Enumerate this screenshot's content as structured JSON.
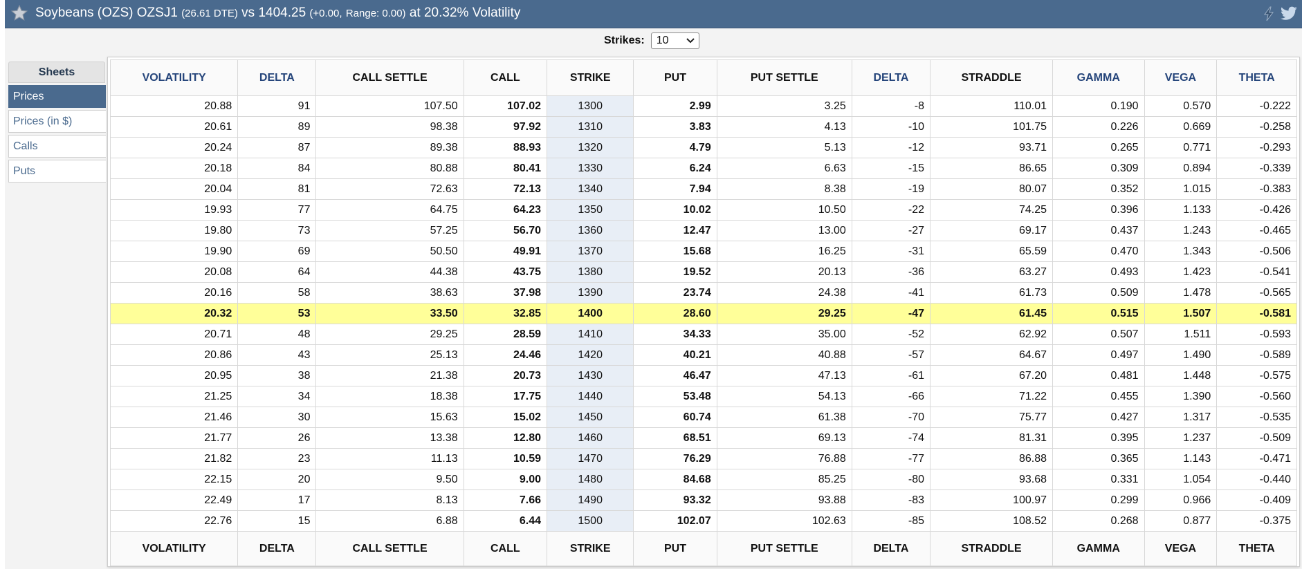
{
  "header": {
    "title_main": "Soybeans (OZS) OZSJ1",
    "dte": "(26.61 DTE)",
    "vs_label": "vs 1404.25",
    "change": "(+0.00,",
    "range": "Range: 0.00)",
    "vol_text": "at 20.32% Volatility"
  },
  "strikes": {
    "label": "Strikes:",
    "value": "10"
  },
  "sidebar": {
    "header": "Sheets",
    "items": [
      {
        "label": "Prices"
      },
      {
        "label": "Prices (in $)"
      },
      {
        "label": "Calls"
      },
      {
        "label": "Puts"
      }
    ]
  },
  "table": {
    "columns": [
      "VOLATILITY",
      "DELTA",
      "CALL SETTLE",
      "CALL",
      "STRIKE",
      "PUT",
      "PUT SETTLE",
      "DELTA",
      "STRADDLE",
      "GAMMA",
      "VEGA",
      "THETA"
    ],
    "rows": [
      [
        "20.88",
        "91",
        "107.50",
        "107.02",
        "1300",
        "2.99",
        "3.25",
        "-8",
        "110.01",
        "0.190",
        "0.570",
        "-0.222"
      ],
      [
        "20.61",
        "89",
        "98.38",
        "97.92",
        "1310",
        "3.83",
        "4.13",
        "-10",
        "101.75",
        "0.226",
        "0.669",
        "-0.258"
      ],
      [
        "20.24",
        "87",
        "89.38",
        "88.93",
        "1320",
        "4.79",
        "5.13",
        "-12",
        "93.71",
        "0.265",
        "0.771",
        "-0.293"
      ],
      [
        "20.18",
        "84",
        "80.88",
        "80.41",
        "1330",
        "6.24",
        "6.63",
        "-15",
        "86.65",
        "0.309",
        "0.894",
        "-0.339"
      ],
      [
        "20.04",
        "81",
        "72.63",
        "72.13",
        "1340",
        "7.94",
        "8.38",
        "-19",
        "80.07",
        "0.352",
        "1.015",
        "-0.383"
      ],
      [
        "19.93",
        "77",
        "64.75",
        "64.23",
        "1350",
        "10.02",
        "10.50",
        "-22",
        "74.25",
        "0.396",
        "1.133",
        "-0.426"
      ],
      [
        "19.80",
        "73",
        "57.25",
        "56.70",
        "1360",
        "12.47",
        "13.00",
        "-27",
        "69.17",
        "0.437",
        "1.243",
        "-0.465"
      ],
      [
        "19.90",
        "69",
        "50.50",
        "49.91",
        "1370",
        "15.68",
        "16.25",
        "-31",
        "65.59",
        "0.470",
        "1.343",
        "-0.506"
      ],
      [
        "20.08",
        "64",
        "44.38",
        "43.75",
        "1380",
        "19.52",
        "20.13",
        "-36",
        "63.27",
        "0.493",
        "1.423",
        "-0.541"
      ],
      [
        "20.16",
        "58",
        "38.63",
        "37.98",
        "1390",
        "23.74",
        "24.38",
        "-41",
        "61.73",
        "0.509",
        "1.478",
        "-0.565"
      ],
      [
        "20.32",
        "53",
        "33.50",
        "32.85",
        "1400",
        "28.60",
        "29.25",
        "-47",
        "61.45",
        "0.515",
        "1.507",
        "-0.581"
      ],
      [
        "20.71",
        "48",
        "29.25",
        "28.59",
        "1410",
        "34.33",
        "35.00",
        "-52",
        "62.92",
        "0.507",
        "1.511",
        "-0.593"
      ],
      [
        "20.86",
        "43",
        "25.13",
        "24.46",
        "1420",
        "40.21",
        "40.88",
        "-57",
        "64.67",
        "0.497",
        "1.490",
        "-0.589"
      ],
      [
        "20.95",
        "38",
        "21.38",
        "20.73",
        "1430",
        "46.47",
        "47.13",
        "-61",
        "67.20",
        "0.481",
        "1.448",
        "-0.575"
      ],
      [
        "21.25",
        "34",
        "18.38",
        "17.75",
        "1440",
        "53.48",
        "54.13",
        "-66",
        "71.22",
        "0.455",
        "1.390",
        "-0.560"
      ],
      [
        "21.46",
        "30",
        "15.63",
        "15.02",
        "1450",
        "60.74",
        "61.38",
        "-70",
        "75.77",
        "0.427",
        "1.317",
        "-0.535"
      ],
      [
        "21.77",
        "26",
        "13.38",
        "12.80",
        "1460",
        "68.51",
        "69.13",
        "-74",
        "81.31",
        "0.395",
        "1.237",
        "-0.509"
      ],
      [
        "21.82",
        "23",
        "11.13",
        "10.59",
        "1470",
        "76.29",
        "76.88",
        "-77",
        "86.88",
        "0.365",
        "1.143",
        "-0.471"
      ],
      [
        "22.15",
        "20",
        "9.50",
        "9.00",
        "1480",
        "84.68",
        "85.25",
        "-80",
        "93.68",
        "0.331",
        "1.054",
        "-0.440"
      ],
      [
        "22.49",
        "17",
        "8.13",
        "7.66",
        "1490",
        "93.32",
        "93.88",
        "-83",
        "100.97",
        "0.299",
        "0.966",
        "-0.409"
      ],
      [
        "22.76",
        "15",
        "6.88",
        "6.44",
        "1500",
        "102.07",
        "102.63",
        "-85",
        "108.52",
        "0.268",
        "0.877",
        "-0.375"
      ]
    ],
    "highlight_strike": "1400"
  },
  "colors": {
    "header_bg": "#4a6a8e",
    "highlight_row": "#ffff99",
    "strike_col": "#e8eef6"
  }
}
